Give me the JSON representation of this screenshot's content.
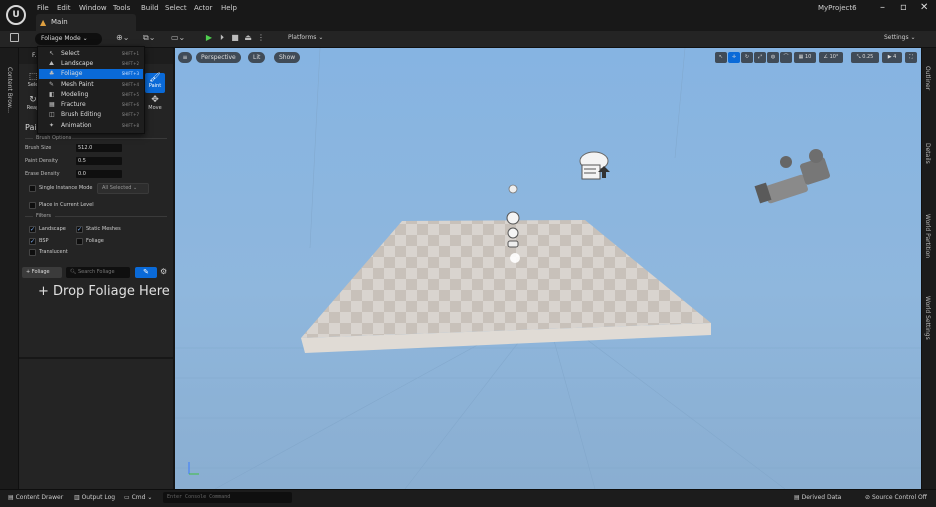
{
  "app": {
    "logo": "U",
    "menu": [
      "File",
      "Edit",
      "Window",
      "Tools",
      "Build",
      "Select",
      "Actor",
      "Help"
    ],
    "project_name": "MyProject6",
    "level_tab": "Main",
    "window_buttons": [
      "–",
      "▫",
      "✕"
    ]
  },
  "toolbar": {
    "mode_button": "Foliage Mode ⌄",
    "platforms": "Platforms ⌄",
    "settings": "Settings ⌄"
  },
  "mode_menu": {
    "items": [
      {
        "label": "Select",
        "shortcut": "SHIFT+1",
        "icon": "select-icon"
      },
      {
        "label": "Landscape",
        "shortcut": "SHIFT+2",
        "icon": "landscape-icon"
      },
      {
        "label": "Foliage",
        "shortcut": "SHIFT+3",
        "icon": "foliage-icon",
        "selected": true
      },
      {
        "label": "Mesh Paint",
        "shortcut": "SHIFT+4",
        "icon": "mesh-paint-icon"
      },
      {
        "label": "Modeling",
        "shortcut": "SHIFT+5",
        "icon": "modeling-icon"
      },
      {
        "label": "Fracture",
        "shortcut": "SHIFT+6",
        "icon": "fracture-icon"
      },
      {
        "label": "Brush Editing",
        "shortcut": "SHIFT+7",
        "icon": "brush-editing-icon"
      },
      {
        "label": "Animation",
        "shortcut": "SHIFT+8",
        "icon": "animation-icon"
      }
    ]
  },
  "left_strip": {
    "content_browser": "Content Brow..."
  },
  "foliage_panel": {
    "tab": "F...",
    "tools": {
      "select": "Sele",
      "reapply": "Reap",
      "paint": "Paint",
      "move": "Move"
    },
    "paint_heading": "Pai",
    "brush_options_label": "Brush Options",
    "brush_size_label": "Brush Size",
    "brush_size_value": "512.0",
    "paint_density_label": "Paint Density",
    "paint_density_value": "0.5",
    "erase_density_label": "Erase Density",
    "erase_density_value": "0.0",
    "single_instance_label": "Single Instance Mode",
    "single_instance_value": "All Selected ⌄",
    "place_current_label": "Place in Current Level",
    "filters_label": "Filters",
    "filters": [
      {
        "label": "Landscape",
        "checked": true
      },
      {
        "label": "Static Meshes",
        "checked": true
      },
      {
        "label": "BSP",
        "checked": true
      },
      {
        "label": "Foliage",
        "checked": false
      },
      {
        "label": "Translucent",
        "checked": false
      }
    ],
    "add_foliage": "+ Foliage",
    "search_placeholder": "Search Foliage",
    "drop_text": "+ Drop Foliage Here"
  },
  "viewport": {
    "perspective": "Perspective",
    "lit": "Lit",
    "show": "Show",
    "grid_size": "10",
    "rotation": "10°",
    "scale": "0.25",
    "camera_speed": "4"
  },
  "right_strip": {
    "outliner": "Outliner",
    "details": "Details",
    "world_partition": "World Partition",
    "world_settings": "World Settings"
  },
  "statusbar": {
    "content_drawer": "Content Drawer",
    "output_log": "Output Log",
    "cmd": "Cmd ⌄",
    "console_placeholder": "Enter Console Command",
    "derived_data": "Derived Data",
    "source_control": "Source Control Off"
  }
}
